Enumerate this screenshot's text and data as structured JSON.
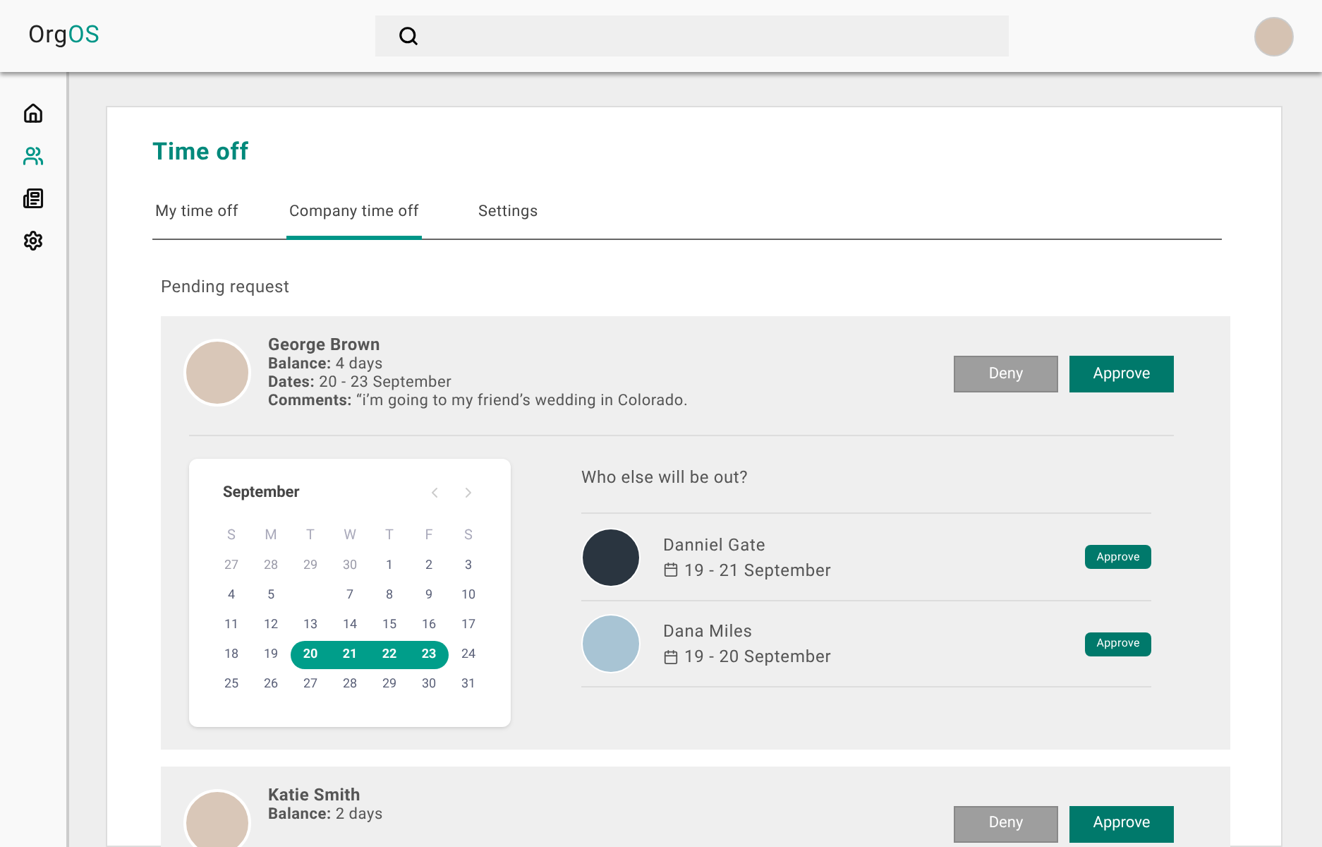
{
  "logo": {
    "parts": [
      "Org",
      "OS"
    ]
  },
  "sidebar": {
    "items": [
      {
        "selected": false
      },
      {
        "selected": true
      },
      {
        "selected": false
      },
      {
        "selected": false
      }
    ]
  },
  "page": {
    "title": "Time off",
    "tabs": [
      {
        "label": "My time off",
        "selected": false
      },
      {
        "label": "Company time off",
        "selected": true
      },
      {
        "label": "Settings",
        "selected": false
      }
    ],
    "section_title": "Pending request",
    "requests": [
      {
        "name": "George Brown",
        "details": [
          "**Balance:** 4 days",
          "**Dates:** 20 - 23 September",
          "**Comments:** “i’m going to my friend’s wedding in Colorado."
        ],
        "deny": "Deny",
        "approve": "Approve",
        "calendar": {
          "month": "September",
          "weekdays": [
            "S",
            "M",
            "T",
            "W",
            "T",
            "F",
            "S"
          ],
          "weeks": [
            [
              {
                "kind": "other",
                "day": "27",
                "selected": false
              },
              {
                "kind": "other",
                "day": "28",
                "selected": false
              },
              {
                "kind": "other",
                "day": "29",
                "selected": false
              },
              {
                "kind": "other",
                "day": "30",
                "selected": false
              },
              {
                "kind": "day",
                "day": "1",
                "selected": false
              },
              {
                "kind": "day",
                "day": "2",
                "selected": false
              },
              {
                "kind": "day",
                "day": "3",
                "selected": false
              }
            ],
            [
              {
                "kind": "day",
                "day": "4",
                "selected": false
              },
              {
                "kind": "day",
                "day": "5",
                "selected": false
              },
              {
                "kind": "blank"
              },
              {
                "kind": "day",
                "day": "7",
                "selected": false
              },
              {
                "kind": "day",
                "day": "8",
                "selected": false
              },
              {
                "kind": "day",
                "day": "9",
                "selected": false
              },
              {
                "kind": "day",
                "day": "10",
                "selected": false
              }
            ],
            [
              {
                "kind": "day",
                "day": "11",
                "selected": false
              },
              {
                "kind": "day",
                "day": "12",
                "selected": false
              },
              {
                "kind": "day",
                "day": "13",
                "selected": false
              },
              {
                "kind": "day",
                "day": "14",
                "selected": false
              },
              {
                "kind": "day",
                "day": "15",
                "selected": false
              },
              {
                "kind": "day",
                "day": "16",
                "selected": false
              },
              {
                "kind": "day",
                "day": "17",
                "selected": false
              }
            ],
            [
              {
                "kind": "day",
                "day": "18",
                "selected": false
              },
              {
                "kind": "day",
                "day": "19",
                "selected": false
              },
              {
                "kind": "day",
                "day": "20",
                "selected": true
              },
              {
                "kind": "day",
                "day": "21",
                "selected": true
              },
              {
                "kind": "day",
                "day": "22",
                "selected": true
              },
              {
                "kind": "day",
                "day": "23",
                "selected": true
              },
              {
                "kind": "day",
                "day": "24",
                "selected": false
              }
            ],
            [
              {
                "kind": "day",
                "day": "25",
                "selected": false
              },
              {
                "kind": "day",
                "day": "26",
                "selected": false
              },
              {
                "kind": "day",
                "day": "27",
                "selected": false
              },
              {
                "kind": "day",
                "day": "28",
                "selected": false
              },
              {
                "kind": "day",
                "day": "29",
                "selected": false
              },
              {
                "kind": "day",
                "day": "30",
                "selected": false
              },
              {
                "kind": "day",
                "day": "31",
                "selected": false
              }
            ]
          ]
        },
        "others_title": "Who else will be out?",
        "others": [
          {
            "name": "Danniel Gate",
            "dates": "19 - 21 September",
            "approve": "Approve",
            "color": "#2a3540"
          },
          {
            "name": "Dana Miles",
            "dates": "19 - 20 September",
            "approve": "Approve",
            "color": "#a8c4d4"
          }
        ]
      },
      {
        "name": "Katie Smith",
        "details": [
          "**Balance:** 2 days"
        ],
        "deny": "Deny",
        "approve": "Approve"
      }
    ]
  }
}
